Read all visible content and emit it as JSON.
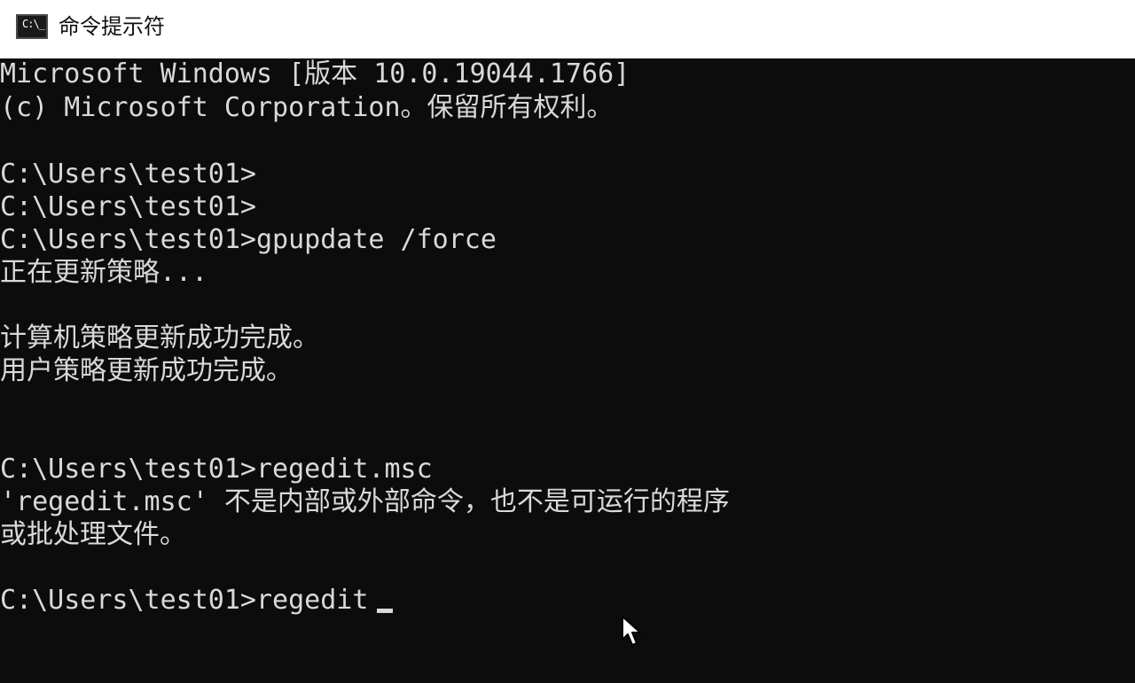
{
  "window": {
    "title": "命令提示符",
    "icon_name": "cmd-icon",
    "icon_glyph": "C:\\_"
  },
  "console": {
    "lines": [
      "Microsoft Windows [版本 10.0.19044.1766]",
      "(c) Microsoft Corporation。保留所有权利。",
      "",
      "C:\\Users\\test01>",
      "C:\\Users\\test01>",
      "C:\\Users\\test01>gpupdate /force",
      "正在更新策略...",
      "",
      "计算机策略更新成功完成。",
      "用户策略更新成功完成。",
      "",
      "",
      "C:\\Users\\test01>regedit.msc",
      "'regedit.msc' 不是内部或外部命令，也不是可运行的程序",
      "或批处理文件。",
      "",
      "C:\\Users\\test01>regedit"
    ]
  },
  "colors": {
    "console_bg": "#0c0c0c",
    "console_text": "#d9d9d9",
    "titlebar_bg": "#ffffff"
  },
  "cursor_icon": "mouse-pointer-icon"
}
